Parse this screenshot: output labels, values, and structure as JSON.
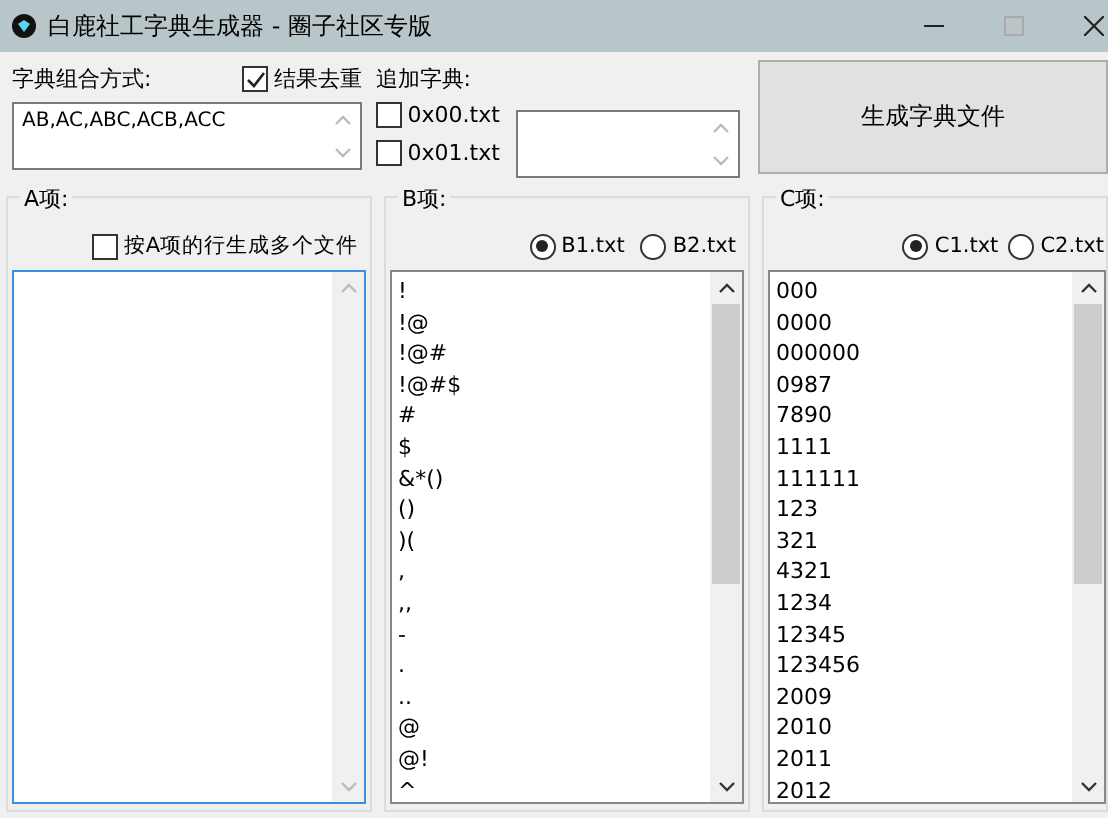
{
  "window": {
    "title": "白鹿社工字典生成器 - 圈子社区专版"
  },
  "combination": {
    "label": "字典组合方式:",
    "value": "AB,AC,ABC,ACB,ACC"
  },
  "dedupe": {
    "label": "结果去重",
    "checked": true
  },
  "append": {
    "label": "追加字典:",
    "files": [
      {
        "label": "0x00.txt",
        "checked": false
      },
      {
        "label": "0x01.txt",
        "checked": false
      }
    ]
  },
  "generate_button": "生成字典文件",
  "groups": [
    {
      "title": "A项:",
      "options": [
        {
          "kind": "checkbox",
          "label": "按A项的行生成多个文件",
          "checked": false
        }
      ],
      "focused": true
    },
    {
      "title": "B项:",
      "options": [
        {
          "kind": "radio",
          "label": "B1.txt",
          "selected": true
        },
        {
          "kind": "radio",
          "label": "B2.txt",
          "selected": false
        }
      ],
      "focused": false,
      "items": [
        "!",
        "!@",
        "!@#",
        "!@#$",
        "#",
        "$",
        "&*()",
        "()",
        ")(",
        ",",
        ",,",
        "-",
        ".",
        "..",
        "@",
        "@!",
        "^"
      ]
    },
    {
      "title": "C项:",
      "options": [
        {
          "kind": "radio",
          "label": "C1.txt",
          "selected": true
        },
        {
          "kind": "radio",
          "label": "C2.txt",
          "selected": false
        }
      ],
      "focused": false,
      "items": [
        "000",
        "0000",
        "000000",
        "0987",
        "7890",
        "1111",
        "111111",
        "123",
        "321",
        "4321",
        "1234",
        "12345",
        "123456",
        "2009",
        "2010",
        "2011",
        "2012"
      ]
    }
  ]
}
